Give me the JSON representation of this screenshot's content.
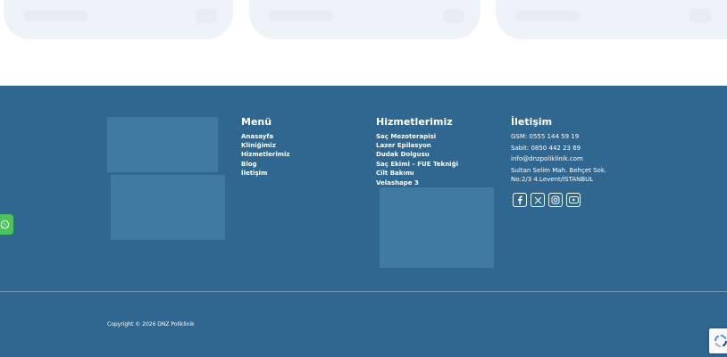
{
  "footer": {
    "menu": {
      "title": "Menü",
      "links": [
        "Anasayfa",
        "Kliniğimiz",
        "Hizmetlerimiz",
        "Blog",
        "İletişim"
      ]
    },
    "services": {
      "title": "Hizmetlerimiz",
      "links": [
        "Saç Mezoterapisi",
        "Lazer Epilasyon",
        "Dudak Dolgusu",
        "Saç Ekimi – FUE Tekniği",
        "Cilt Bakımı",
        "Velashape 3"
      ]
    },
    "contact": {
      "title": "İletişim",
      "gsm": "GSM: 0555 144 59 19",
      "phone": "Sabit: 0850 442 23 69",
      "email": "info@dnzpoliklinik.com",
      "address_line1": "Sultan Selim Mah. Behçet Sok.",
      "address_line2": "No:2/3 4.Levent/İSTANBUL"
    },
    "social_icons": [
      "facebook-icon",
      "x-icon",
      "instagram-icon",
      "youtube-icon"
    ],
    "copyright": "Copyright © 2026 DNZ Poliklinik"
  },
  "floating": {
    "whatsapp_icon": "whatsapp-icon",
    "recaptcha_icon": "recaptcha-icon"
  },
  "colors": {
    "footer_bg": "#2f6790",
    "placeholder": "#3f7aa3",
    "card_bg": "#eef2f9",
    "whatsapp": "#4cc25b"
  }
}
